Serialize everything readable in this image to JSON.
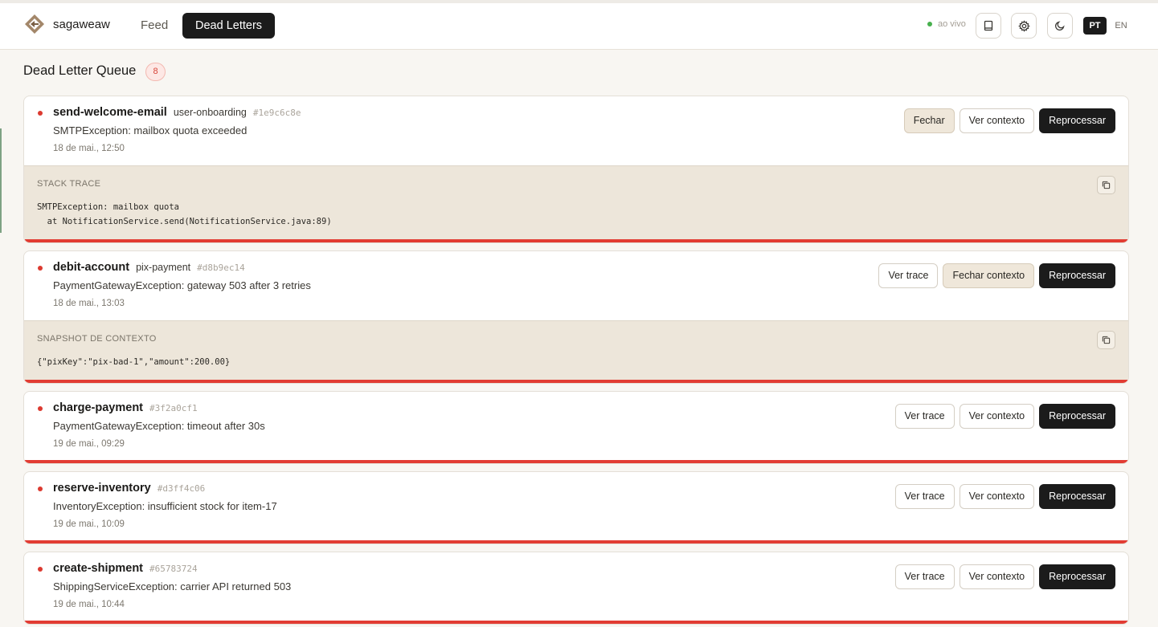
{
  "header": {
    "brand": "sagaweaw",
    "nav_feed": "Feed",
    "nav_dead_letters": "Dead Letters",
    "live_label": "ao vivo",
    "icon_docs": "book-icon",
    "icon_settings": "gear-icon",
    "icon_theme": "moon-icon",
    "lang_pt": "PT",
    "lang_en": "EN"
  },
  "page": {
    "title": "Dead Letter Queue",
    "count": "8"
  },
  "cards": [
    {
      "step": "send-welcome-email",
      "saga": "user-onboarding",
      "hash": "#1e9c6c8e",
      "error": "SMTPException: mailbox quota exceeded",
      "timestamp": "18 de mai., 12:50",
      "btn_left": "Fechar",
      "btn_mid": "Ver contexto",
      "btn_primary": "Reprocessar",
      "detail_title": "STACK TRACE",
      "detail_lines": [
        "SMTPException: mailbox quota",
        "  at NotificationService.send(NotificationService.java:89)"
      ]
    },
    {
      "step": "debit-account",
      "saga": "pix-payment",
      "hash": "#d8b9ec14",
      "error": "PaymentGatewayException: gateway 503 after 3 retries",
      "timestamp": "18 de mai., 13:03",
      "btn_left": "Ver trace",
      "btn_mid": "Fechar contexto",
      "btn_primary": "Reprocessar",
      "detail_title": "SNAPSHOT DE CONTEXTO",
      "detail_lines": [
        "{\"pixKey\":\"pix-bad-1\",\"amount\":200.00}"
      ]
    },
    {
      "step": "charge-payment",
      "hash": "#3f2a0cf1",
      "error": "PaymentGatewayException: timeout after 30s",
      "timestamp": "19 de mai., 09:29",
      "btn_left": "Ver trace",
      "btn_mid": "Ver contexto",
      "btn_primary": "Reprocessar"
    },
    {
      "step": "reserve-inventory",
      "hash": "#d3ff4c06",
      "error": "InventoryException: insufficient stock for item-17",
      "timestamp": "19 de mai., 10:09",
      "btn_left": "Ver trace",
      "btn_mid": "Ver contexto",
      "btn_primary": "Reprocessar"
    },
    {
      "step": "create-shipment",
      "hash": "#65783724",
      "error": "ShippingServiceException: carrier API returned 503",
      "timestamp": "19 de mai., 10:44",
      "btn_left": "Ver trace",
      "btn_mid": "Ver contexto",
      "btn_primary": "Reprocessar"
    }
  ],
  "icons": {
    "copy": "copy-icon"
  }
}
